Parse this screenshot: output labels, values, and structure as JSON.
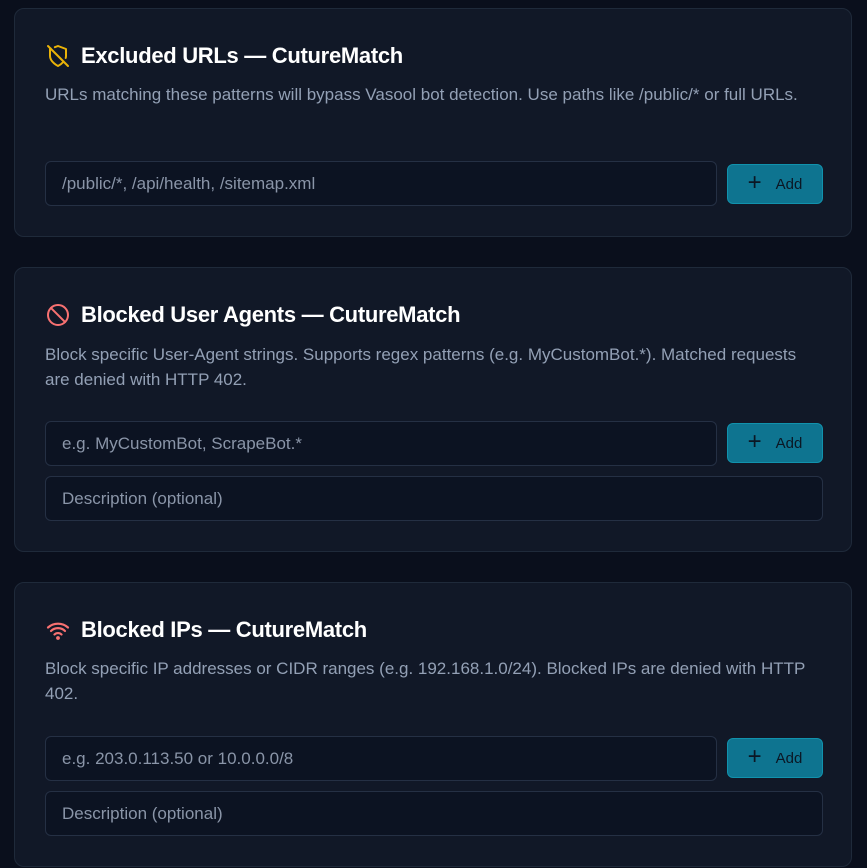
{
  "excluded_urls": {
    "title": "Excluded URLs — CutureMatch",
    "icon": "shield-off-icon",
    "icon_color": "#eab308",
    "description": "URLs matching these patterns will bypass Vasool bot detection. Use paths like /public/* or full URLs.",
    "input_placeholder": "/public/*, /api/health, /sitemap.xml",
    "add_label": "Add"
  },
  "blocked_agents": {
    "title": "Blocked User Agents — CutureMatch",
    "icon": "ban-icon",
    "icon_color": "#f87171",
    "description": "Block specific User-Agent strings. Supports regex patterns (e.g. MyCustomBot.*). Matched requests are denied with HTTP 402.",
    "input_placeholder": "e.g. MyCustomBot, ScrapeBot.*",
    "description_placeholder": "Description (optional)",
    "add_label": "Add"
  },
  "blocked_ips": {
    "title": "Blocked IPs — CutureMatch",
    "icon": "wifi-icon",
    "icon_color": "#f87171",
    "description": "Block specific IP addresses or CIDR ranges (e.g. 192.168.1.0/24). Blocked IPs are denied with HTTP 402.",
    "input_placeholder": "e.g. 203.0.113.50 or 10.0.0.0/8",
    "description_placeholder": "Description (optional)",
    "add_label": "Add"
  },
  "colors": {
    "accent": "#0e7490",
    "background": "#0a0f1c",
    "card": "#111827"
  }
}
